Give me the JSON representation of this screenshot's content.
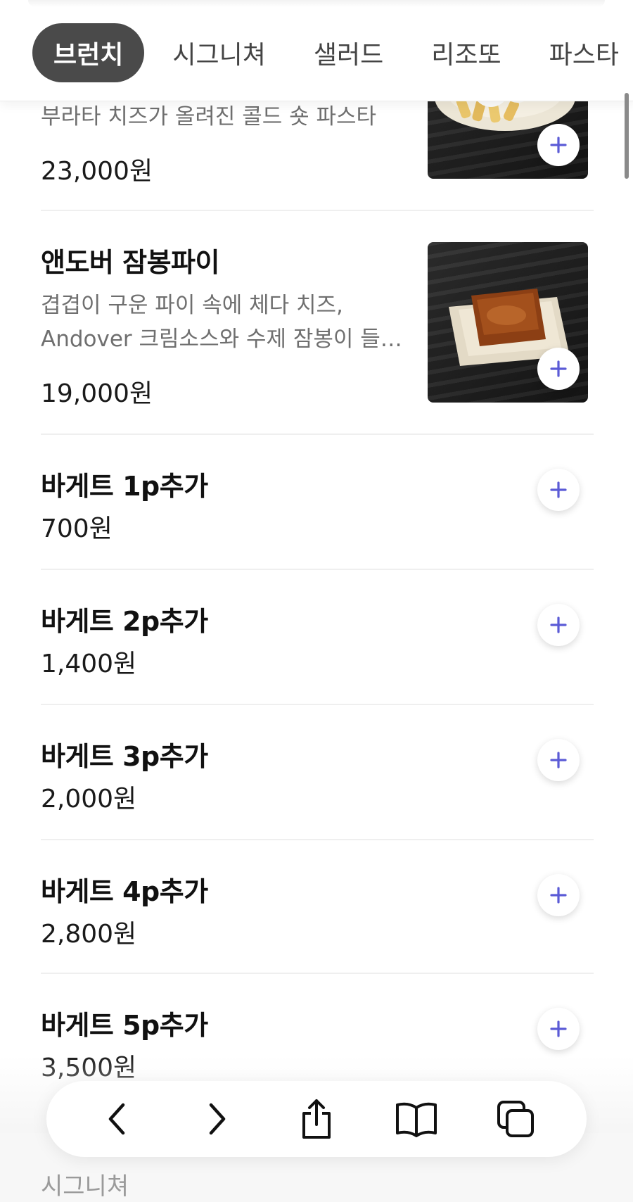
{
  "tabs": [
    {
      "label": "브런치",
      "active": true
    },
    {
      "label": "시그니쳐",
      "active": false
    },
    {
      "label": "샐러드",
      "active": false
    },
    {
      "label": "리조또",
      "active": false
    },
    {
      "label": "파스타",
      "active": false
    }
  ],
  "items": [
    {
      "description": "부라타 치즈가 올려진 콜드 숏 파스타",
      "price": "23,000원"
    },
    {
      "name": "앤도버 잠봉파이",
      "description_line1": "겹겹이 구운 파이 속에 체다 치즈,",
      "description_line2": "Andover 크림소스와 수제 잠봉이 들…",
      "price": "19,000원"
    },
    {
      "name": "바게트 1p추가",
      "price": "700원"
    },
    {
      "name": "바게트 2p추가",
      "price": "1,400원"
    },
    {
      "name": "바게트 3p추가",
      "price": "2,000원"
    },
    {
      "name": "바게트 4p추가",
      "price": "2,800원"
    },
    {
      "name": "바게트 5p추가",
      "price": "3,500원"
    }
  ],
  "next_section": "시그니쳐",
  "colors": {
    "accent": "#5b5bd6",
    "active_tab": "#4a4a4a"
  },
  "toolbar_icons": [
    "back-icon",
    "forward-icon",
    "share-icon",
    "bookmarks-icon",
    "tabs-icon"
  ]
}
